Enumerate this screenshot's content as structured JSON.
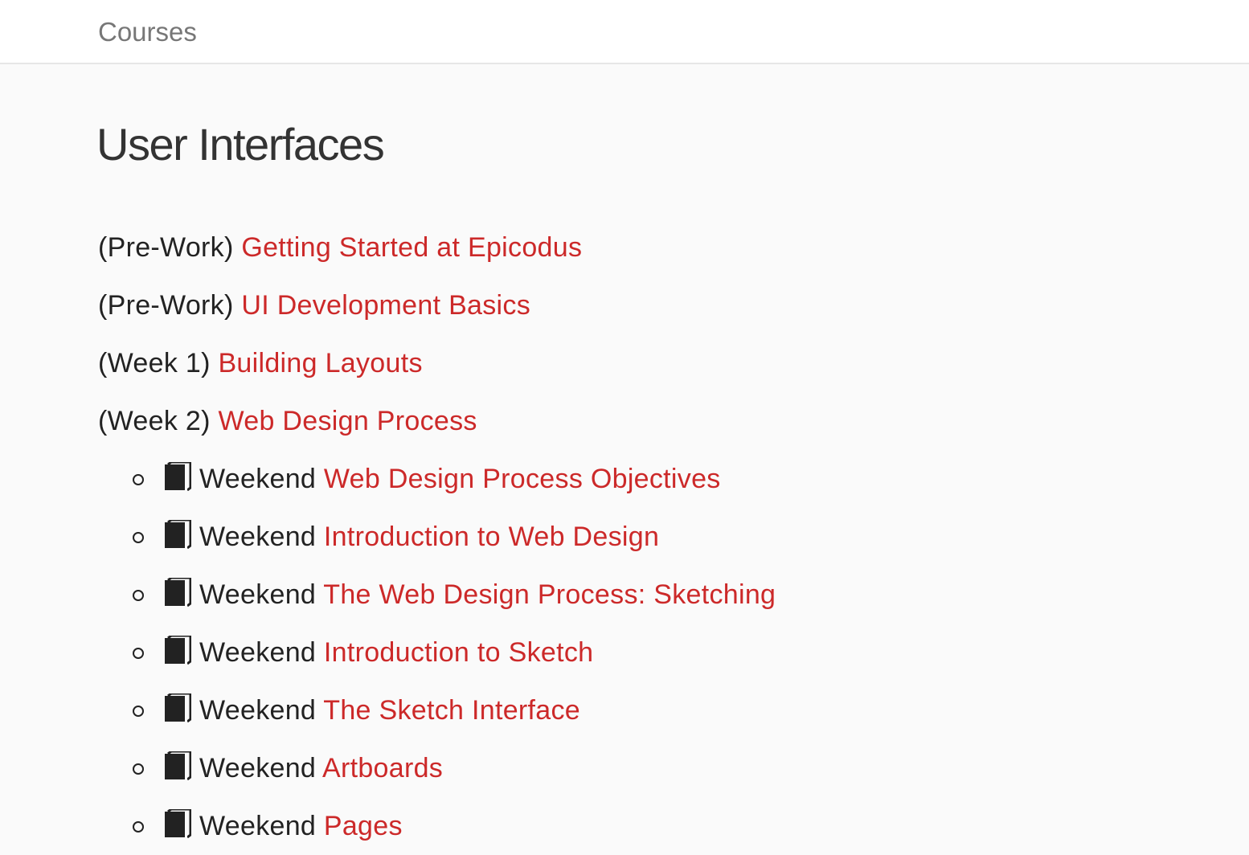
{
  "nav": {
    "courses_label": "Courses"
  },
  "page": {
    "title": "User Interfaces"
  },
  "lessons": [
    {
      "prefix": "(Pre-Work)",
      "title": "Getting Started at Epicodus"
    },
    {
      "prefix": "(Pre-Work)",
      "title": "UI Development Basics"
    },
    {
      "prefix": "(Week 1)",
      "title": "Building Layouts"
    },
    {
      "prefix": "(Week 2)",
      "title": "Web Design Process"
    }
  ],
  "sublessons": [
    {
      "icon": "book-icon",
      "label": "Weekend",
      "title": "Web Design Process Objectives"
    },
    {
      "icon": "book-icon",
      "label": "Weekend",
      "title": "Introduction to Web Design"
    },
    {
      "icon": "book-icon",
      "label": "Weekend",
      "title": "The Web Design Process: Sketching"
    },
    {
      "icon": "book-icon",
      "label": "Weekend",
      "title": "Introduction to Sketch"
    },
    {
      "icon": "book-icon",
      "label": "Weekend",
      "title": "The Sketch Interface"
    },
    {
      "icon": "book-icon",
      "label": "Weekend",
      "title": "Artboards"
    },
    {
      "icon": "book-icon",
      "label": "Weekend",
      "title": "Pages"
    }
  ],
  "colors": {
    "link": "#cc2929",
    "text": "#222222",
    "nav_text": "#777777",
    "background": "#fafafa"
  }
}
